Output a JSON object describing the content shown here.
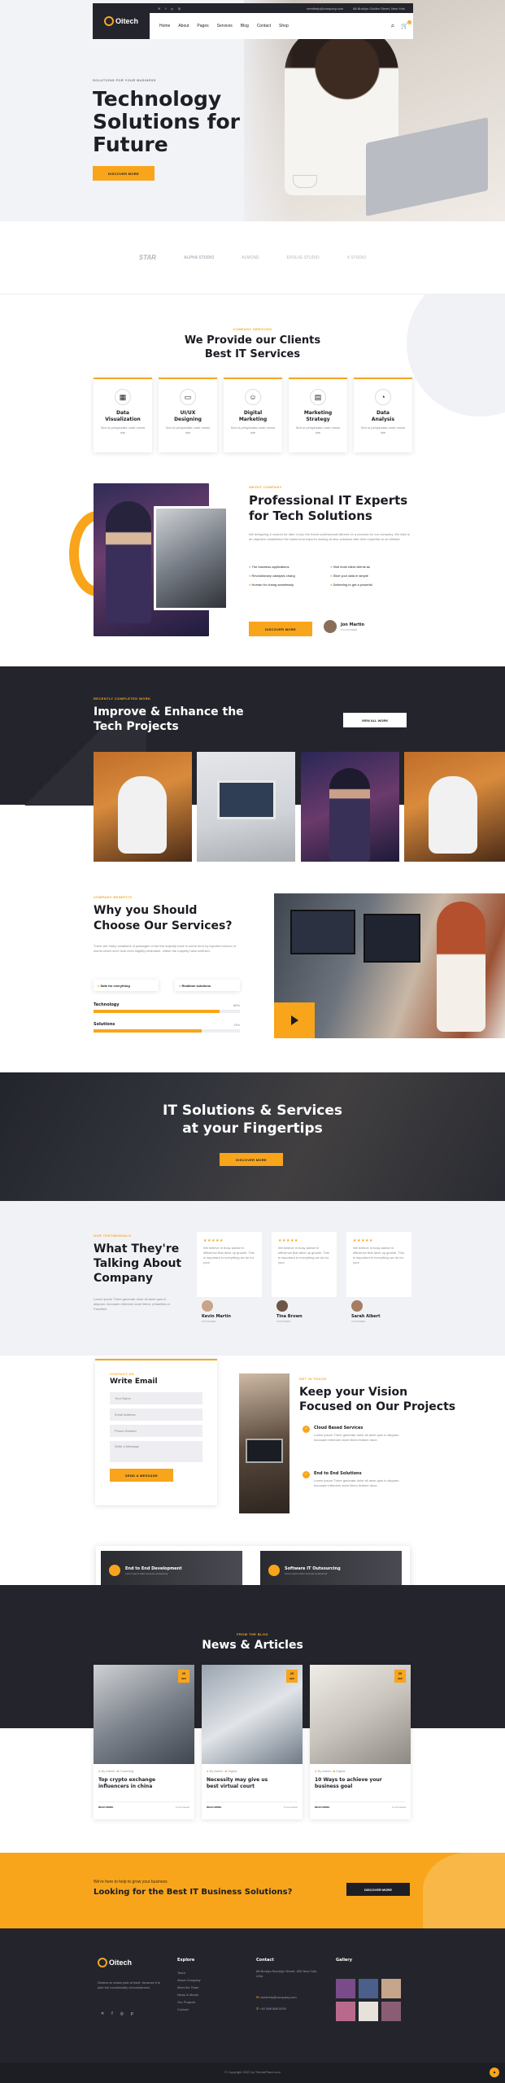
{
  "topbar": {
    "email": "needhelp@company.com",
    "address": "88 Broklyn Golden Street, New York"
  },
  "header": {
    "logo": "Oitech",
    "nav": [
      "Home",
      "About",
      "Pages",
      "Services",
      "Blog",
      "Contact",
      "Shop"
    ],
    "cart_count": "0"
  },
  "hero": {
    "tag": "SOLUTIONS FOR YOUR BUSINESS",
    "title_line1": "Technology",
    "title_line2": "Solutions for",
    "title_line3": "Future",
    "button": "DISCOVER MORE"
  },
  "brands": [
    "STAR",
    "ALPHA STUDIO",
    "ALMOND",
    "EVOLVE STUDIO",
    "X STUDIO"
  ],
  "services": {
    "tag": "COMPANY SERVICES",
    "title_line1": "We Provide our Clients",
    "title_line2": "Best IT Services",
    "items": [
      {
        "l1": "Data",
        "l2": "Visualization",
        "text": "Sed ut perspiciatis unde omnis iste"
      },
      {
        "l1": "UI/UX",
        "l2": "Designing",
        "text": "Sed ut perspiciatis unde omnis iste"
      },
      {
        "l1": "Digital",
        "l2": "Marketing",
        "text": "Sed ut perspiciatis unde omnis iste"
      },
      {
        "l1": "Marketing",
        "l2": "Strategy",
        "text": "Sed ut perspiciatis unde omnis iste"
      },
      {
        "l1": "Data",
        "l2": "Analysis",
        "text": "Sed ut perspiciatis unde omnis iste"
      }
    ]
  },
  "about": {
    "tag": "ABOUT COMPANY",
    "title_line1": "Professional IT Experts",
    "title_line2": "for Tech Solutions",
    "text": "We designing & custom for take of you the future professional tailored on a process for our company. We take is an objective established the latest best expert's looking at also solutions with their expertise to an brilliant.",
    "checks": [
      "The business applications",
      "Revolutionary catalysts chang",
      "Human for chang seamlessly",
      "Visit most client clients as",
      "Slice your data in simple",
      "Delivering to get a powerful"
    ],
    "button": "DISCOVER MORE",
    "author_name": "Jon Martin",
    "author_role": "CO-FOUNDER"
  },
  "projects": {
    "tag": "RECENTLY COMPLETED WORK",
    "title_line1": "Improve & Enhance the",
    "title_line2": "Tech Projects",
    "button": "VIEW ALL WORK"
  },
  "why": {
    "tag": "COMPANY BENEFITS",
    "title_line1": "Why you Should",
    "title_line2": "Choose Our Services?",
    "text": "There are many variations of passages of but the majority have in some form by injected humour or words which don't look even slightly believable. Utilize the majority have suffered.",
    "pill1": "Safe for everything",
    "pill2": "Realtime solutions",
    "bars": [
      {
        "label": "Technology",
        "value": "86%",
        "fill": 0.86
      },
      {
        "label": "Solutions",
        "value": "74%",
        "fill": 0.74
      }
    ]
  },
  "cta_banner": {
    "title_line1": "IT Solutions & Services",
    "title_line2": "at your Fingertips",
    "button": "DISCOVER MORE"
  },
  "testimonials": {
    "tag": "OUR TESTIMONIALS",
    "title_line1": "What They're",
    "title_line2": "Talking About",
    "title_line3": "Company",
    "text": "Lorem ipsum There generate dolor sit amet quis in aliquam. Accusam interdum done libero, phasellus ut. Faucibus",
    "items": [
      {
        "stars": "★★★★★",
        "quote": "We believe in busy advice in efficience that drive up growth. This is important in everything we do for your.",
        "name": "Kevin Martin",
        "role": "CUSTOMER"
      },
      {
        "stars": "★★★★★",
        "quote": "We believe in busy advice in efficience that drive up growth. This is important in everything we do for your.",
        "name": "Tina Brown",
        "role": "CUSTOMER"
      },
      {
        "stars": "★★★★★",
        "quote": "We believe in busy advice in efficience that drive up growth. This is important in everything we do for your.",
        "name": "Sarah Albert",
        "role": "CUSTOMER"
      }
    ]
  },
  "contact_form": {
    "tag": "CONTACT US",
    "title": "Write Email",
    "fields": [
      "Your Name",
      "Email Address",
      "Phone Number",
      "Write a Message"
    ],
    "button": "SEND A MESSAGE"
  },
  "vision": {
    "tag": "GET IN TOUCH",
    "title_line1": "Keep your Vision",
    "title_line2": "Focused on Our Projects",
    "items": [
      {
        "title": "Cloud Based Services",
        "text": "Lorem ipsum There generate dolor sit amet quis in aliquam. Accusam interdum done libero feature done."
      },
      {
        "title": "End to End Solutions",
        "text": "Lorem ipsum There generate dolor sit amet quis in aliquam. Accusam interdum done libero feature done."
      }
    ]
  },
  "dev_cards": [
    {
      "title": "End to End Development",
      "text": "Lorem ipsum dolor sit amet consectetur"
    },
    {
      "title": "Software IT Outsourcing",
      "text": "Lorem ipsum dolor sit amet consectetur"
    }
  ],
  "news": {
    "tag": "FROM THE BLOG",
    "title": "News & Articles",
    "items": [
      {
        "day": "20",
        "month": "SEP",
        "author": "By Admin",
        "category": "Coaching",
        "l1": "Top crypto exchange",
        "l2": "influencers in china",
        "more": "READ MORE",
        "comments": "2 Comments"
      },
      {
        "day": "20",
        "month": "SEP",
        "author": "By Admin",
        "category": "Digital",
        "l1": "Necessity may give us",
        "l2": "best virtual court",
        "more": "READ MORE",
        "comments": "2 Comments"
      },
      {
        "day": "20",
        "month": "SEP",
        "author": "By Admin",
        "category": "Digital",
        "l1": "10 Ways to achieve your",
        "l2": "business goal",
        "more": "READ MORE",
        "comments": "2 Comments"
      }
    ]
  },
  "help": {
    "small": "We're here to help to grow your business",
    "title": "Looking for the Best IT Business Solutions?",
    "button": "DISCOVER MORE"
  },
  "footer": {
    "logo": "Oitech",
    "about": "Desires to obtain pain of itself, because it is pain but occasionally circumstances.",
    "explore_title": "Explore",
    "explore": [
      "Team",
      "About Company",
      "Meet the Team",
      "News & Media",
      "Our Projects",
      "Contact"
    ],
    "contact_title": "Contact",
    "address": "88 Broklyn Brooklyn Street, 600 New York, USA",
    "email": "needhelp@company.com",
    "phone": "+92 666 888 0000",
    "gallery_title": "Gallery",
    "copyright": "© Copyright 2022 by ThemePlace.com"
  }
}
